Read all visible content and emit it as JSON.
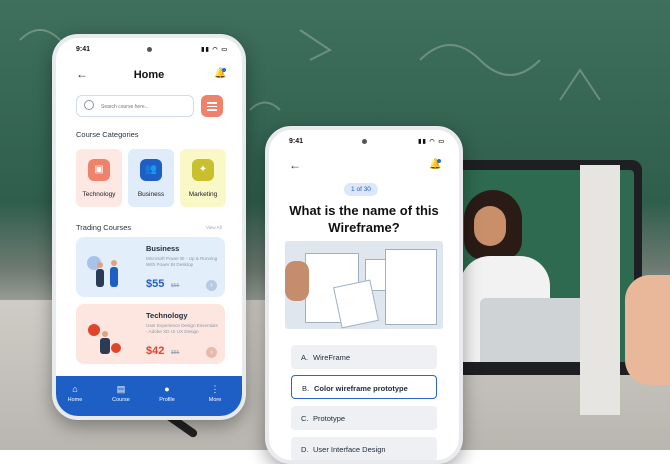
{
  "home_phone": {
    "status_time": "9:41",
    "title": "Home",
    "search_placeholder": "Search course here...",
    "categories_title": "Course Categories",
    "categories": [
      {
        "label": "Technology",
        "bg": "#fde8e3",
        "icon_bg": "#f0826b",
        "icon": "chip-icon"
      },
      {
        "label": "Business",
        "bg": "#e1ecfb",
        "icon_bg": "#1e5fc6",
        "icon": "people-icon"
      },
      {
        "label": "Marketing",
        "bg": "#fbf8c7",
        "icon_bg": "#c8c02f",
        "icon": "megaphone-icon"
      }
    ],
    "trading_title": "Trading Courses",
    "view_all": "View All",
    "courses": [
      {
        "name": "Business",
        "desc": "Microsoft Power BI - Up & Running With Power BI Desktop",
        "price": "$55",
        "old_price": "$55",
        "bg": "#e3eefb",
        "accent": "#1e5fc6"
      },
      {
        "name": "Technology",
        "desc": "User Experience Design Essentials - Adobe XD UI UX Design",
        "price": "$42",
        "old_price": "$55",
        "bg": "#fde6df",
        "accent": "#e0452a"
      }
    ],
    "nav": [
      {
        "label": "Home",
        "icon": "home-icon"
      },
      {
        "label": "Course",
        "icon": "book-icon"
      },
      {
        "label": "Profile",
        "icon": "user-icon"
      },
      {
        "label": "More",
        "icon": "more-icon"
      }
    ]
  },
  "quiz_phone": {
    "status_time": "9:41",
    "progress": "1 of 30",
    "question": "What is the name of this Wireframe?",
    "options": [
      {
        "letter": "A.",
        "text": "WireFrame",
        "selected": false
      },
      {
        "letter": "B.",
        "text": "Color wireframe prototype",
        "selected": true
      },
      {
        "letter": "C.",
        "text": "Prototype",
        "selected": false
      },
      {
        "letter": "D.",
        "text": "User Interface Design",
        "selected": false
      }
    ]
  }
}
